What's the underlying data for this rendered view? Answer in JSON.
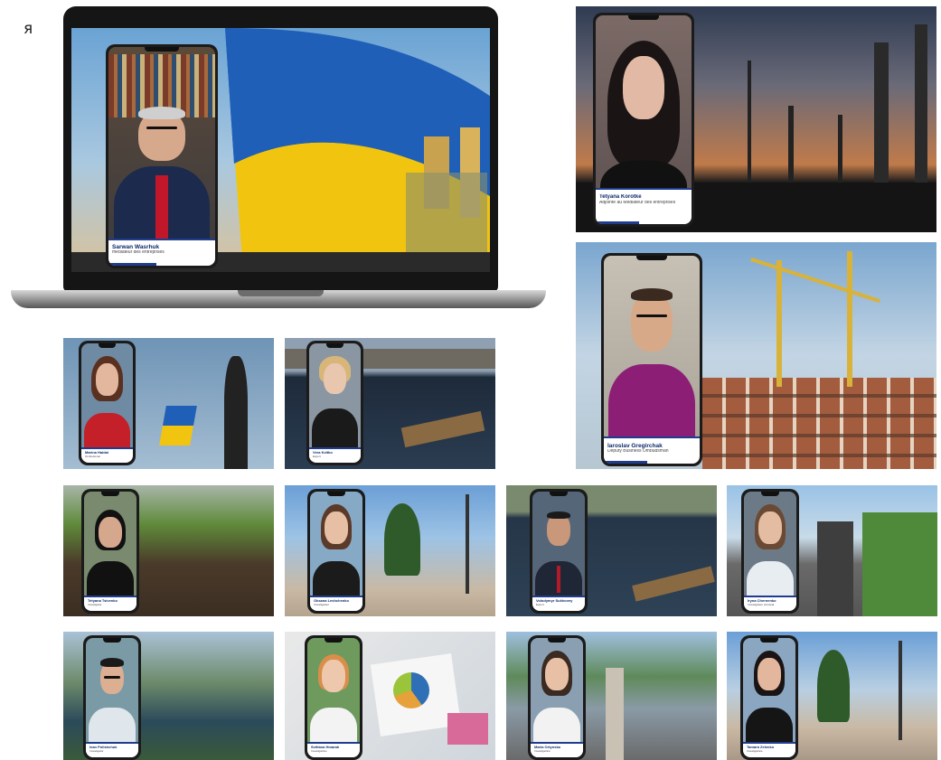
{
  "corner_glyph": "я",
  "featured": {
    "name": "Sarwan Wasrhuk",
    "role": "mediateur des entreprises"
  },
  "tiles": [
    {
      "name": "Tetyana Korotke",
      "role": "Adjointe au Mediateur des entreprises"
    },
    {
      "name": "Iaroslav Gregirchak",
      "role": "Deputy Business Ombudsman"
    },
    {
      "name": "Marina Haidai",
      "role": "Ombudsman"
    },
    {
      "name": "Vera Kvitko",
      "role": "Expert"
    },
    {
      "name": "Tetyana Tsivenko",
      "role": "Investigator"
    },
    {
      "name": "Oksana Leshchenko",
      "role": "Investigateur"
    },
    {
      "name": "Volodymyr Sukhovey",
      "role": "Expert"
    },
    {
      "name": "Iryna Chernenko",
      "role": "Investigateur principal"
    },
    {
      "name": "Ivan Polishchuk",
      "role": "Investigator"
    },
    {
      "name": "Svitlana Hmarah",
      "role": "Investigatrice"
    },
    {
      "name": "Maria Ortynska",
      "role": "Investigatrice"
    },
    {
      "name": "Tamara Zelenko",
      "role": "Investigatrice"
    }
  ],
  "colors": {
    "caption_accent": "#1f3c8f",
    "name_text": "#0c2a6b",
    "flag_blue": "#1f5fb8",
    "flag_yellow": "#f1c40f"
  },
  "icons": [
    "laptop-icon",
    "phone-frame-icon"
  ]
}
